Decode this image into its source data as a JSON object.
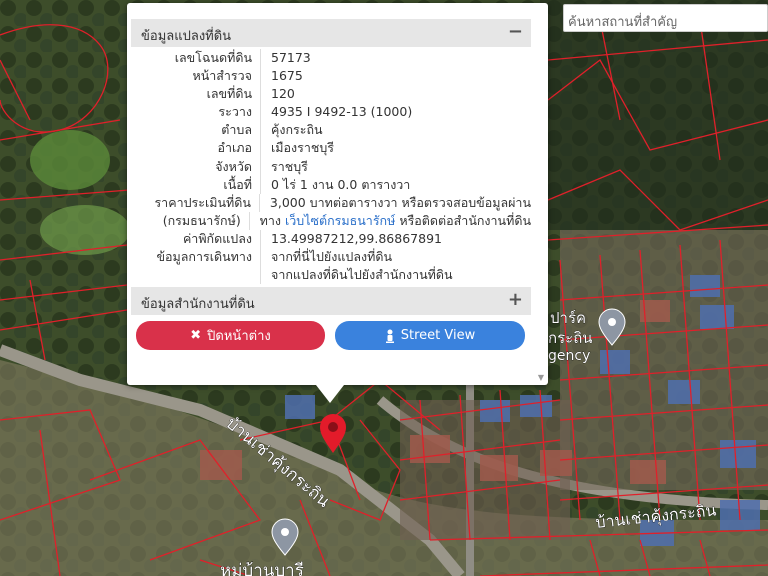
{
  "search": {
    "placeholder": "ค้นหาสถานที่สำคัญ"
  },
  "map": {
    "labels": {
      "road_1": "บ้านเช่าคุ้งกระถิน",
      "road_2": "บ้านเช่าคุ้งกระถิน",
      "poi_1": "ปาร์ค",
      "poi_2": "กระถิน",
      "poi_3": "gency",
      "poi_4": "หมู่บ้านบารี"
    }
  },
  "popup": {
    "land_section": {
      "title": "ข้อมูลแปลงที่ดิน",
      "toggle": "−"
    },
    "fields": {
      "deed_label": "เลขโฉนดที่ดิน",
      "deed_value": "57173",
      "survey_label": "หน้าสำรวจ",
      "survey_value": "1675",
      "parcel_label": "เลขที่ดิน",
      "parcel_value": "120",
      "sheet_label": "ระวาง",
      "sheet_value": "4935 I 9492-13 (1000)",
      "subdistrict_label": "ตำบล",
      "subdistrict_value": "คุ้งกระถิน",
      "district_label": "อำเภอ",
      "district_value": "เมืองราชบุรี",
      "province_label": "จังหวัด",
      "province_value": "ราชบุรี",
      "area_label": "เนื้อที่",
      "area_value": "0 ไร่ 1 งาน 0.0 ตารางวา",
      "price_label": "ราคาประเมินที่ดิน",
      "price_value": "3,000 บาทต่อตารางวา หรือตรวจสอบข้อมูลผ่าน",
      "dept_label": "(กรมธนารักษ์)",
      "dept_value_pre": "ทาง",
      "dept_link": "เว็บไซต์กรมธนารักษ์",
      "dept_value_post": "หรือติดต่อสำนักงานที่ดิน",
      "coord_label": "ค่าพิกัดแปลง",
      "coord_value": "13.49987212,99.86867891",
      "travel_label": "ข้อมูลการเดินทาง",
      "travel_link_1": "จากที่นี่ไปยังแปลงที่ดิน",
      "travel_link_2": "จากแปลงที่ดินไปยังสำนักงานที่ดิน"
    },
    "office_section": {
      "title": "ข้อมูลสำนักงานที่ดิน",
      "toggle": "+"
    },
    "buttons": {
      "close_label": "ปิดหน้าต่าง",
      "streetview_label": "Street View"
    },
    "colors": {
      "close": "#d9314a",
      "streetview": "#3a82dd",
      "link": "#2a6fc9"
    }
  }
}
